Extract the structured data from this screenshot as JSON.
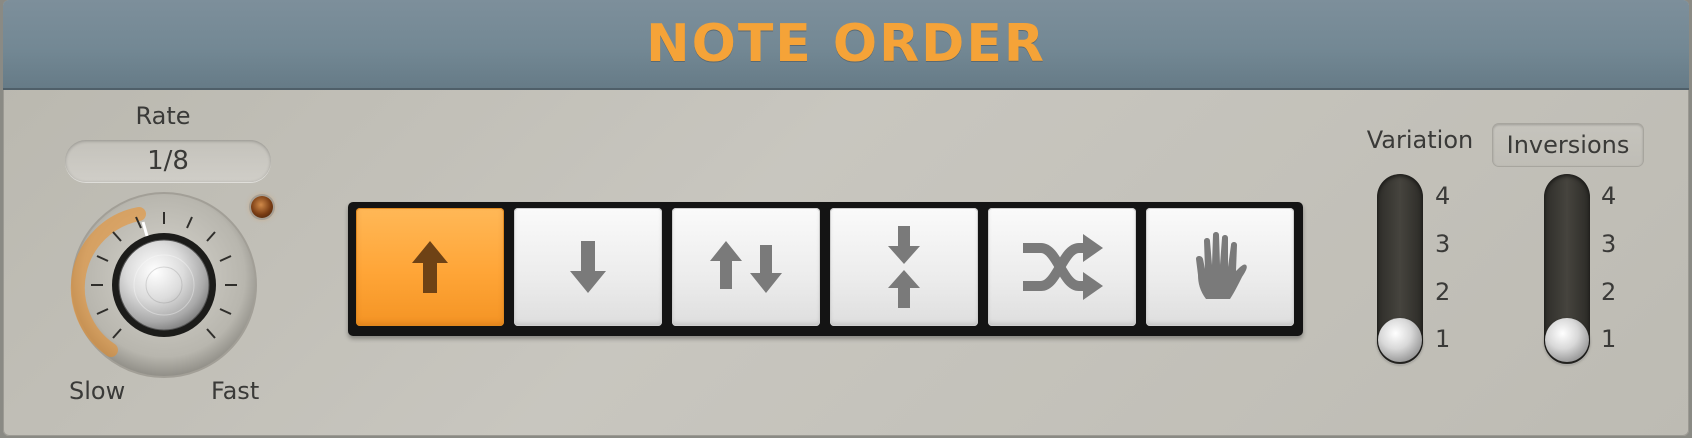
{
  "header": {
    "title": "NOTE ORDER"
  },
  "rate": {
    "label": "Rate",
    "value": "1/8",
    "slow_label": "Slow",
    "fast_label": "Fast"
  },
  "modes": [
    {
      "name": "up",
      "icon": "arrow-up-icon",
      "active": true
    },
    {
      "name": "down",
      "icon": "arrow-down-icon",
      "active": false
    },
    {
      "name": "up-down",
      "icon": "arrow-up-down-icon",
      "active": false
    },
    {
      "name": "outside-in",
      "icon": "arrows-converge-icon",
      "active": false
    },
    {
      "name": "random",
      "icon": "shuffle-icon",
      "active": false
    },
    {
      "name": "as-played",
      "icon": "hand-icon",
      "active": false
    }
  ],
  "variation": {
    "label": "Variation",
    "ticks": [
      "4",
      "3",
      "2",
      "1"
    ],
    "value": 1
  },
  "inversions": {
    "label": "Inversions",
    "ticks": [
      "4",
      "3",
      "2",
      "1"
    ],
    "value": 1
  },
  "colors": {
    "accent": "#f5a338",
    "header": "#738894",
    "panel": "#c4c2bb"
  }
}
